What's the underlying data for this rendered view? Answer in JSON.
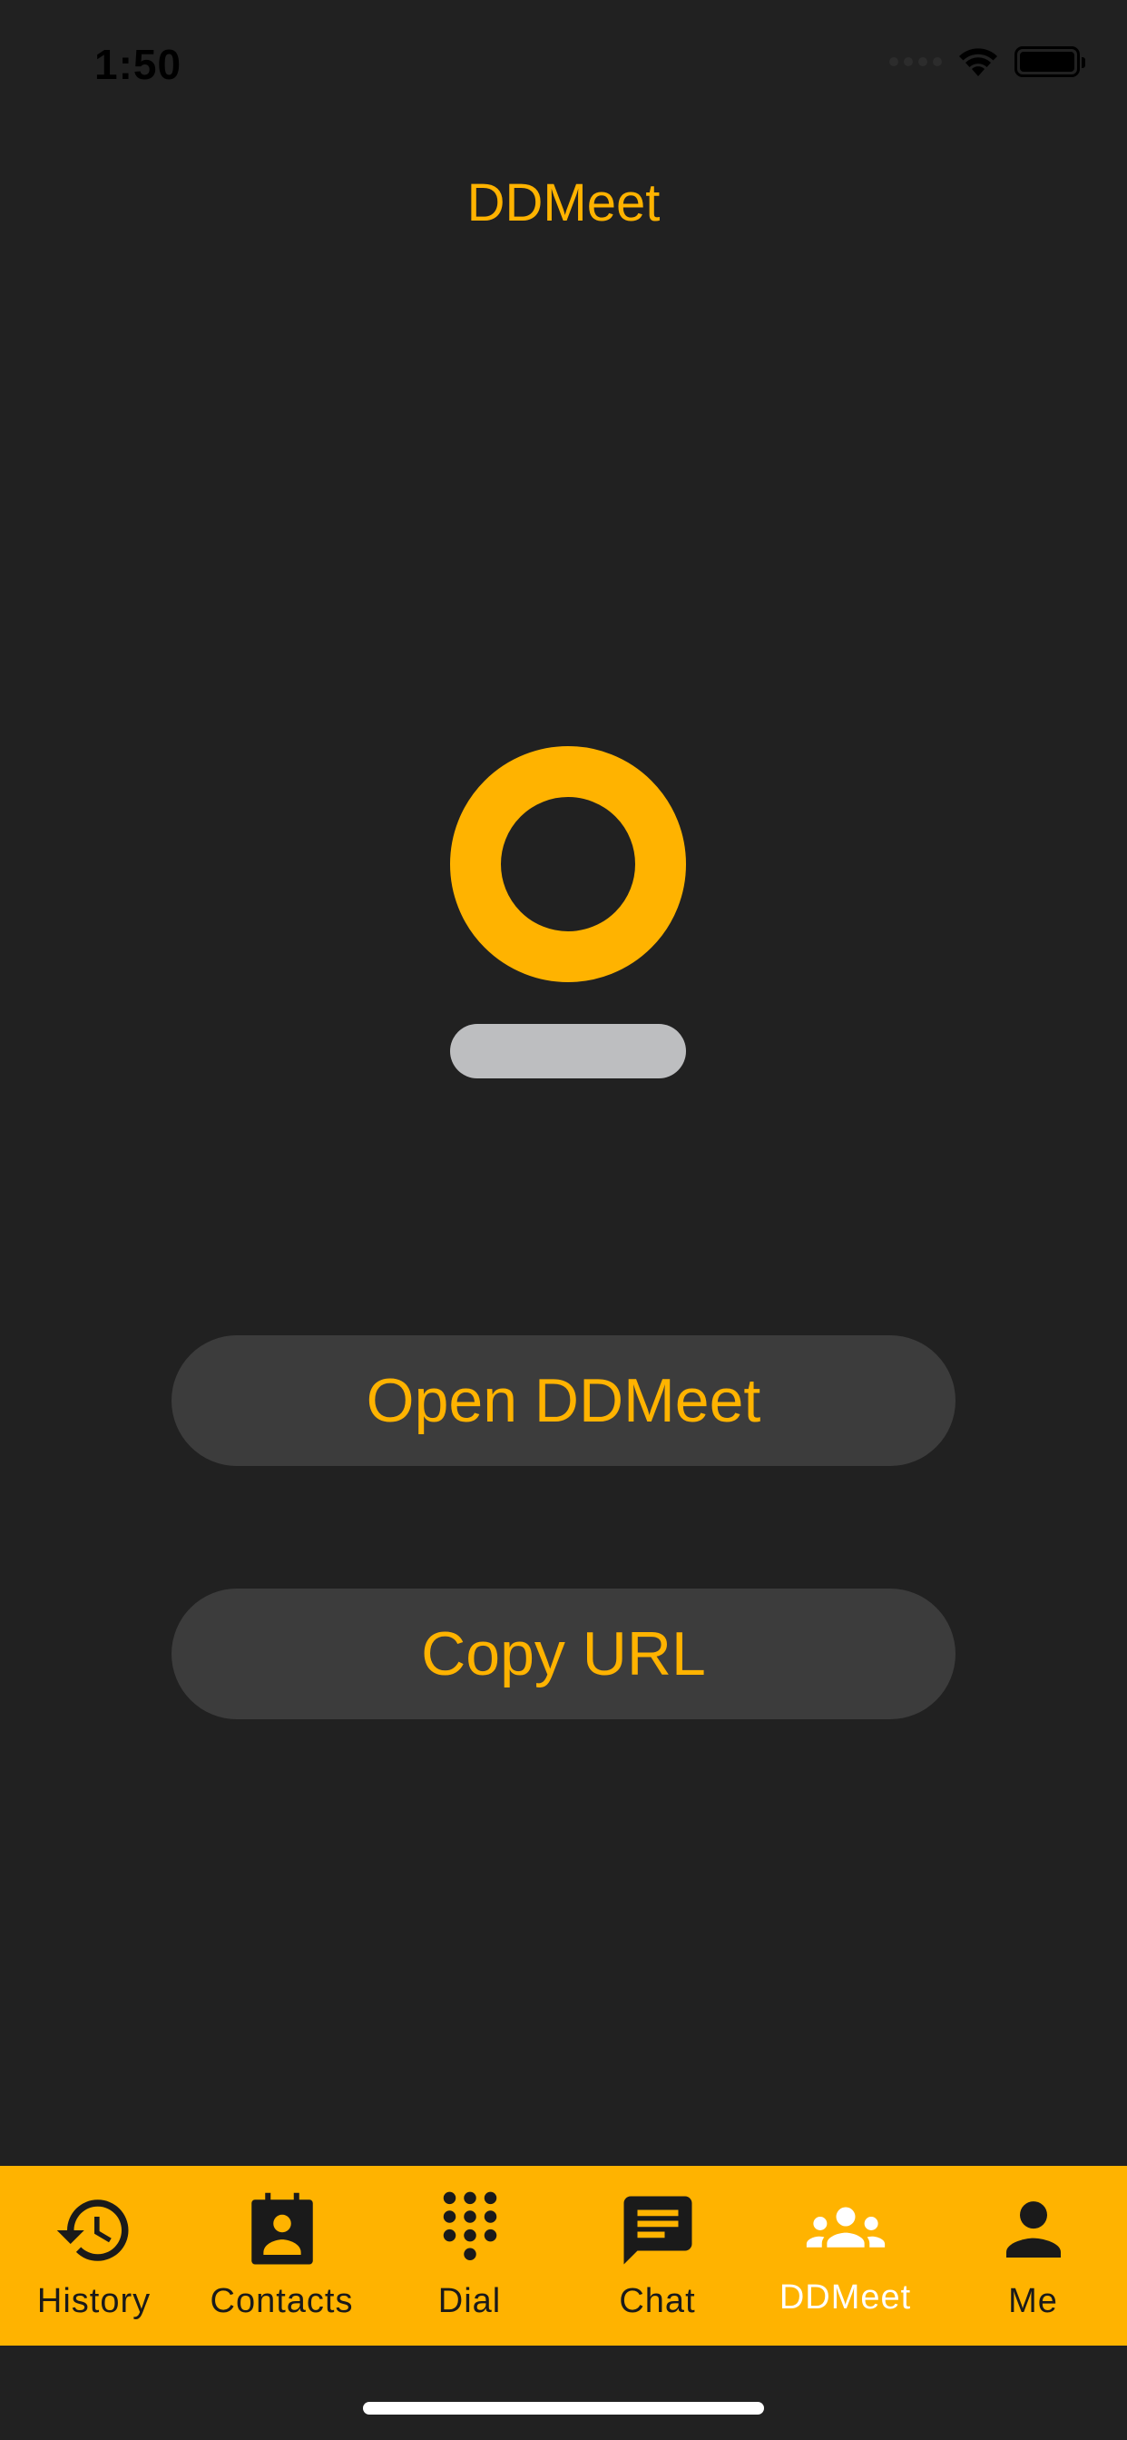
{
  "status_bar": {
    "time": "1:50"
  },
  "header": {
    "title": "DDMeet"
  },
  "actions": {
    "open_label": "Open DDMeet",
    "copy_label": "Copy URL"
  },
  "tabs": [
    {
      "label": "History",
      "icon": "history-icon"
    },
    {
      "label": "Contacts",
      "icon": "contacts-icon"
    },
    {
      "label": "Dial",
      "icon": "dialpad-icon"
    },
    {
      "label": "Chat",
      "icon": "chat-icon"
    },
    {
      "label": "DDMeet",
      "icon": "group-icon",
      "active": true
    },
    {
      "label": "Me",
      "icon": "person-icon"
    }
  ],
  "colors": {
    "background": "#212121",
    "accent": "#FFB300",
    "button_bg": "#3C3C3C",
    "logo_bar": "#BDBEC0"
  }
}
